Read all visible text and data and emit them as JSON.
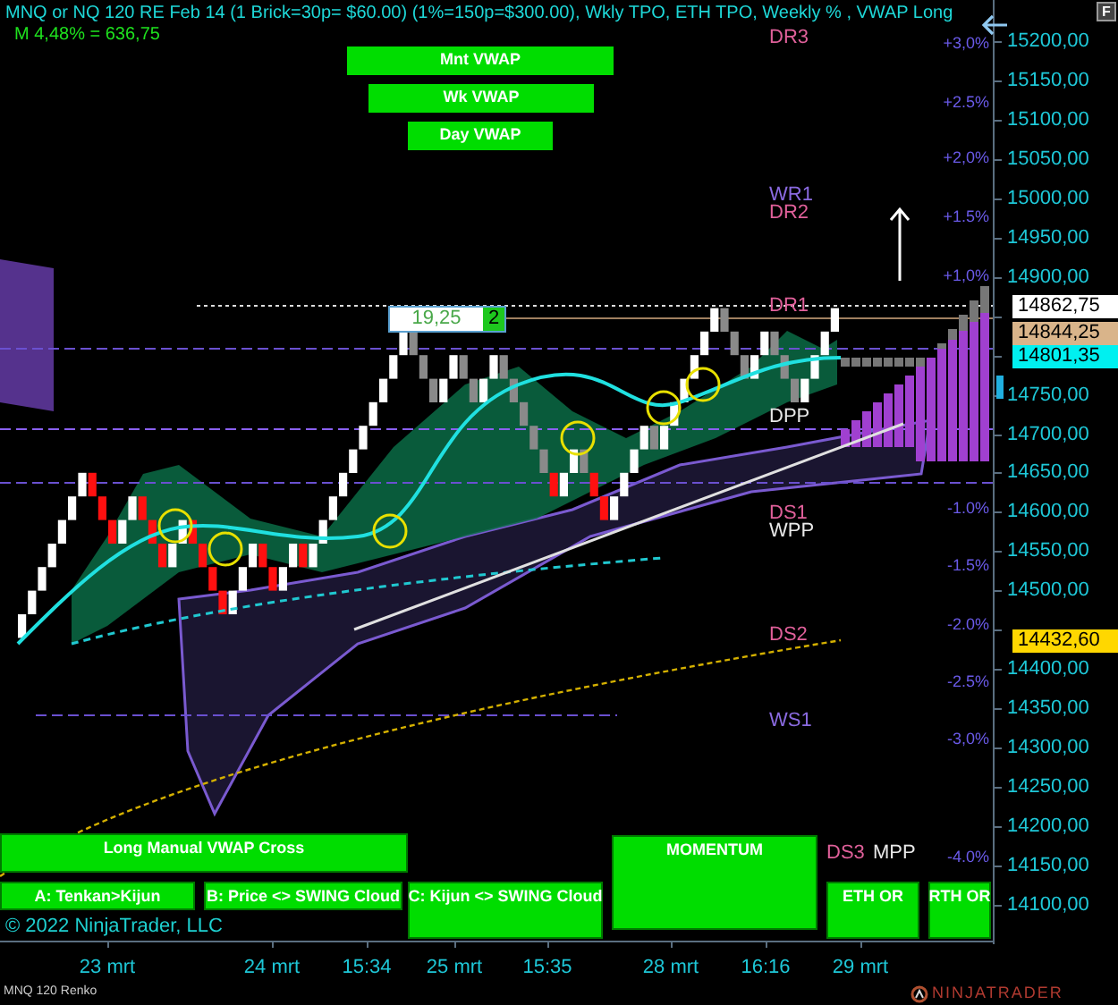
{
  "header": {
    "title": "MNQ or NQ 120 RE Feb 14 (1 Brick=30p= $60.00) (1%=150p=$300.00), Wkly TPO, ETH TPO, Weekly % , VWAP Long",
    "subtitle": "M 4,48% = 636,75"
  },
  "vwap_buttons": [
    "Mnt VWAP",
    "Wk VWAP",
    "Day VWAP"
  ],
  "pivot_labels": [
    {
      "text": "DR3",
      "color": "#e0609a"
    },
    {
      "text": "WR1",
      "color": "#8a6ae0"
    },
    {
      "text": "DR2",
      "color": "#e0609a"
    },
    {
      "text": "DR1",
      "color": "#e0609a"
    },
    {
      "text": "DPP",
      "color": "#e8e8e8"
    },
    {
      "text": "DS1",
      "color": "#e0609a"
    },
    {
      "text": "WPP",
      "color": "#e8e8e8"
    },
    {
      "text": "DS2",
      "color": "#e0609a"
    },
    {
      "text": "WS1",
      "color": "#8a6ae0"
    },
    {
      "text": "DS3",
      "color": "#e0609a"
    },
    {
      "text": "MPP",
      "color": "#e8e8e8"
    }
  ],
  "percent_labels": [
    "+3,0%",
    "+2.5%",
    "+2,0%",
    "+1.5%",
    "+1,0%",
    "-1.0%",
    "-1.5%",
    "-2.0%",
    "-2.5%",
    "-3,0%",
    "-4.0%"
  ],
  "price_axis": {
    "labels": [
      "15200,00",
      "15150,00",
      "15100,00",
      "15050,00",
      "15000,00",
      "14950,00",
      "14900,00",
      "14750,00",
      "14700,00",
      "14650,00",
      "14600,00",
      "14550,00",
      "14500,00",
      "14400,00",
      "14350,00",
      "14300,00",
      "14250,00",
      "14200,00",
      "14150,00",
      "14100,00"
    ],
    "markers": [
      {
        "text": "14862,75",
        "color": "#ffffff"
      },
      {
        "text": "14844,25",
        "color": "#d9b48a"
      },
      {
        "text": "14801,35",
        "color": "#00f0f0"
      },
      {
        "text": "14432,60",
        "color": "#ffd700"
      }
    ]
  },
  "position_box": {
    "value": "19,25",
    "count": "2"
  },
  "signal_buttons": [
    "Long Manual VWAP Cross",
    "A: Tenkan>Kijun",
    "B: Price <> SWING Cloud",
    "C: Kijun <> SWING Cloud",
    "MOMENTUM",
    "ETH OR",
    "RTH OR"
  ],
  "copyright": "© 2022 NinjaTrader, LLC",
  "time_axis": [
    "23 mrt",
    "24 mrt",
    "15:34",
    "25 mrt",
    "15:35",
    "28 mrt",
    "16:16",
    "29 mrt"
  ],
  "instrument_label": "MNQ 120 Renko",
  "logo": "NINJATRADER",
  "corner_button": "F"
}
